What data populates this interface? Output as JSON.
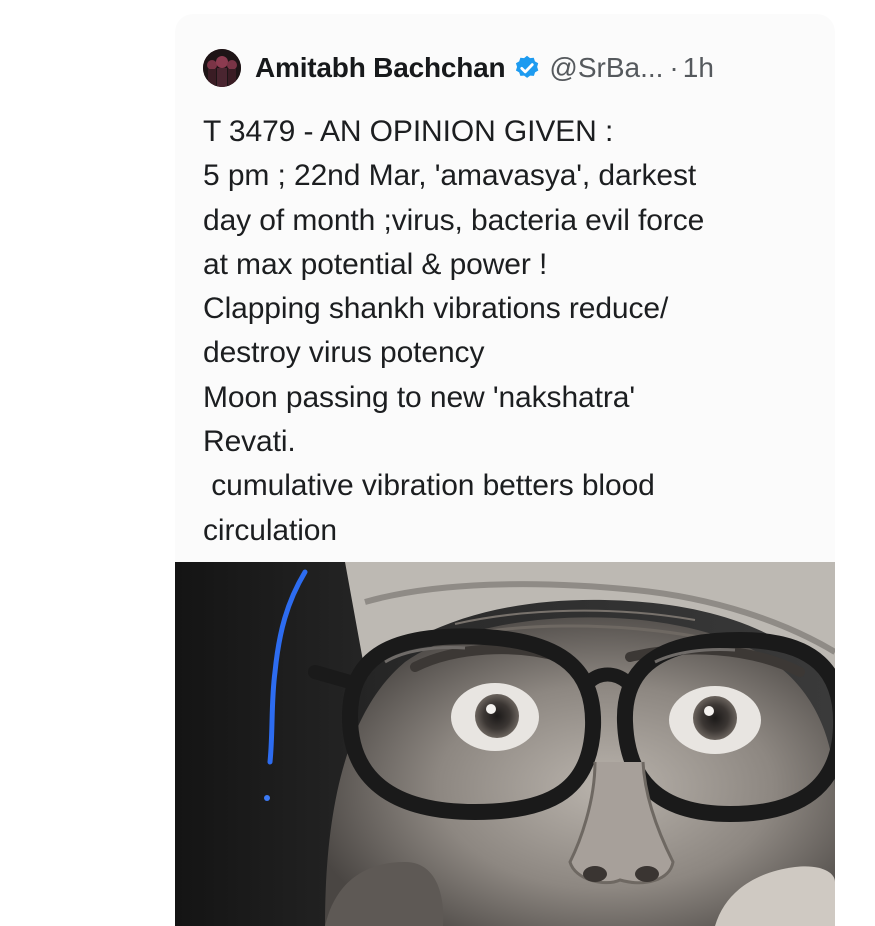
{
  "tweet": {
    "author_name": "Amitabh Bachchan",
    "handle": "@SrBa...",
    "separator": "·",
    "time": "1h",
    "icons": {
      "avatar": "profile-avatar",
      "verified": "verified-badge-icon"
    },
    "lines": [
      "T 3479 - AN OPINION GIVEN :",
      "5 pm ; 22nd Mar, 'amavasya', darkest",
      "day of month ;virus, bacteria evil force",
      "at max potential & power !",
      "Clapping shankh vibrations reduce/",
      "destroy virus potency",
      "Moon passing to new 'nakshatra'",
      "Revati.",
      " cumulative vibration betters blood",
      "circulation"
    ],
    "media": "photo-close-up-face-with-round-glasses"
  },
  "colors": {
    "verified_blue": "#1d9bf0",
    "text": "#1c1e20",
    "muted": "#55595d"
  }
}
